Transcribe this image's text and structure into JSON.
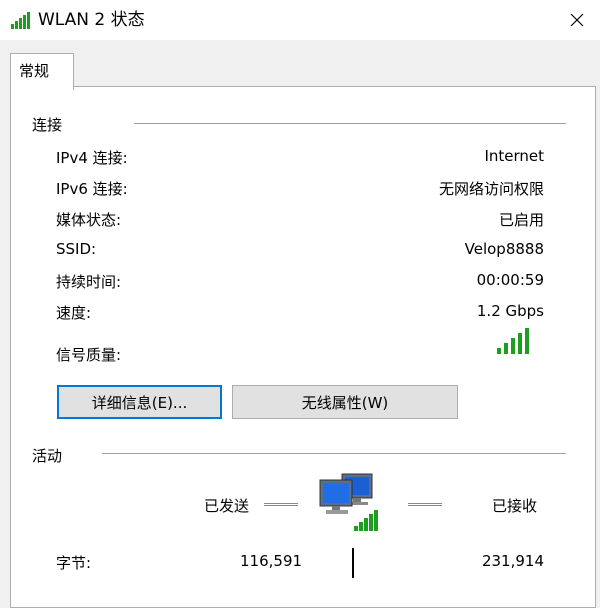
{
  "window": {
    "title": "WLAN 2 状态"
  },
  "tabs": [
    {
      "label": "常规"
    }
  ],
  "connection": {
    "heading": "连接",
    "rows": [
      {
        "label": "IPv4 连接:",
        "value": "Internet"
      },
      {
        "label": "IPv6 连接:",
        "value": "无网络访问权限"
      },
      {
        "label": "媒体状态:",
        "value": "已启用"
      },
      {
        "label": "SSID:",
        "value": "Velop8888"
      },
      {
        "label": "持续时间:",
        "value": "00:00:59"
      },
      {
        "label": "速度:",
        "value": "1.2 Gbps"
      }
    ],
    "signal_label": "信号质量:",
    "signal_bars_lit": 5,
    "signal_bars_total": 5
  },
  "buttons": {
    "details": "详细信息(E)...",
    "wireless": "无线属性(W)"
  },
  "activity": {
    "heading": "活动",
    "sent_label": "已发送",
    "received_label": "已接收",
    "bytes_label": "字节:",
    "bytes_sent": "116,591",
    "bytes_received": "231,914"
  },
  "colors": {
    "signal_green": "#1e9e1e",
    "focus_blue": "#0078d7",
    "button_face": "#e1e1e1"
  },
  "icons": [
    "wifi-signal-icon",
    "close-icon",
    "network-computers-icon"
  ]
}
